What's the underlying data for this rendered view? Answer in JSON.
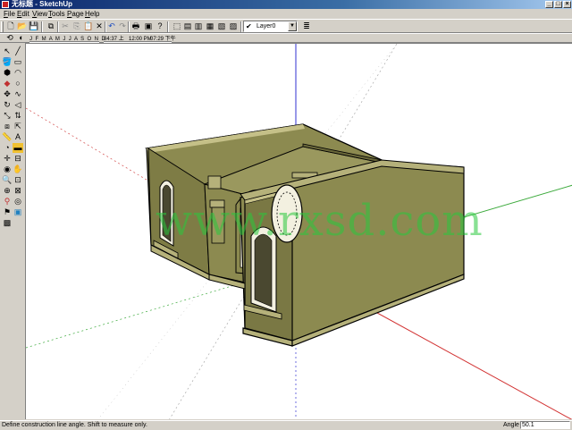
{
  "window": {
    "title": "无标题 - SketchUp"
  },
  "menu": [
    "File",
    "Edit",
    "View",
    "Tools",
    "Page",
    "Help"
  ],
  "layers": {
    "current": "Layer0"
  },
  "shadow": {
    "months": "J F M A M J J A S O N D",
    "sunrise": "04:37 上",
    "noon": "12:00 PM",
    "sunset": "07:29 下午"
  },
  "viewport": {
    "watermark": "www.rxsd.com"
  },
  "status": {
    "message": "Define construction line angle.  Shift to measure only.",
    "vcb_label": "Angle",
    "vcb_value": "50.1"
  },
  "colors": {
    "wall": "#8c8a50",
    "wall_dark": "#7a7844",
    "roof": "#b5b17a",
    "axis_red": "#d23232",
    "axis_green": "#3caa3c",
    "axis_blue": "#3232d2"
  }
}
